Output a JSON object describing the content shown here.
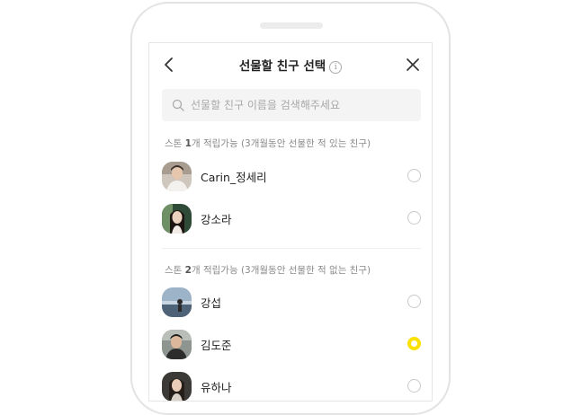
{
  "header": {
    "title": "선물할 친구 선택",
    "info_icon": "info-icon",
    "back_icon": "chevron-left-icon",
    "close_icon": "close-icon"
  },
  "search": {
    "placeholder": "선물할 친구 이름을 검색해주세요",
    "value": ""
  },
  "sections": [
    {
      "prefix": "스톤 ",
      "count": "1",
      "suffix": "개 적립가능 (3개월동안 선물한 적 있는 친구)",
      "friends": [
        {
          "name": "Carin_정세리",
          "selected": false
        },
        {
          "name": "강소라",
          "selected": false
        }
      ]
    },
    {
      "prefix": "스톤 ",
      "count": "2",
      "suffix": "개 적립가능 (3개월동안 선물한 적 없는 친구)",
      "friends": [
        {
          "name": "강섭",
          "selected": false
        },
        {
          "name": "김도준",
          "selected": true
        },
        {
          "name": "유하나",
          "selected": false
        }
      ]
    }
  ],
  "colors": {
    "accent": "#fae100",
    "radio_border": "#c9c9c9",
    "search_bg": "#f4f4f4"
  }
}
